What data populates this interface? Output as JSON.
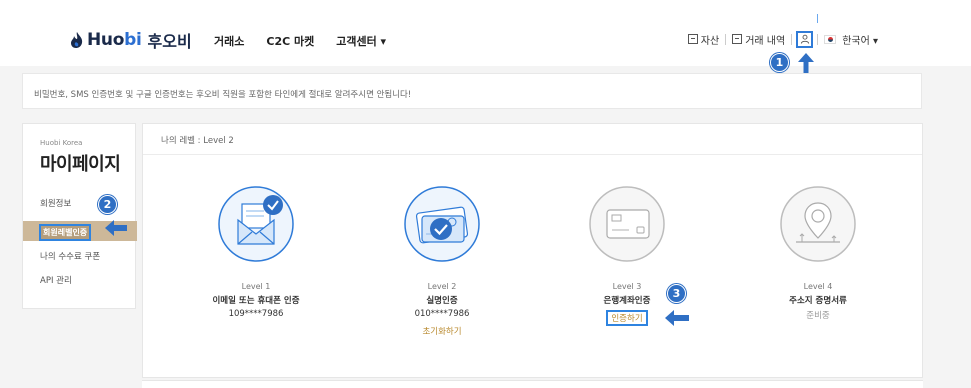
{
  "header": {
    "logo_brand_a": "Huo",
    "logo_brand_b": "bi",
    "logo_korean": "후오비",
    "nav": [
      "거래소",
      "C2C 마켓",
      "고객센터 ▾"
    ],
    "right": {
      "assets": "자산",
      "history": "거래 내역",
      "language": "한국어 ▾"
    }
  },
  "notice": "비밀번호, SMS 인증번호 및 구글 인증번호는 후오비 직원을 포함한 타인에게 절대로 알려주시면 안됩니다!",
  "sidebar": {
    "subtitle": "Huobi Korea",
    "title": "마이페이지",
    "items": [
      "회원정보",
      "회원레벨인증",
      "나의 수수료 쿠폰",
      "API 관리"
    ]
  },
  "main": {
    "level_header": "나의 레벨 : Level 2",
    "levels": [
      {
        "name": "Level 1",
        "desc": "이메일 또는 휴대폰 인증",
        "value": "109****7986"
      },
      {
        "name": "Level 2",
        "desc": "실명인증",
        "value": "010****7986",
        "link": "초기화하기"
      },
      {
        "name": "Level 3",
        "desc": "은행계좌인증",
        "link": "인증하기"
      },
      {
        "name": "Level 4",
        "desc": "주소지 증명서류",
        "status": "준비중"
      }
    ]
  },
  "annotations": [
    "1",
    "2",
    "3"
  ],
  "colors": {
    "accent_blue": "#2f6fc4",
    "highlight_gold": "#cdb899",
    "link_gold": "#b98a2e"
  }
}
